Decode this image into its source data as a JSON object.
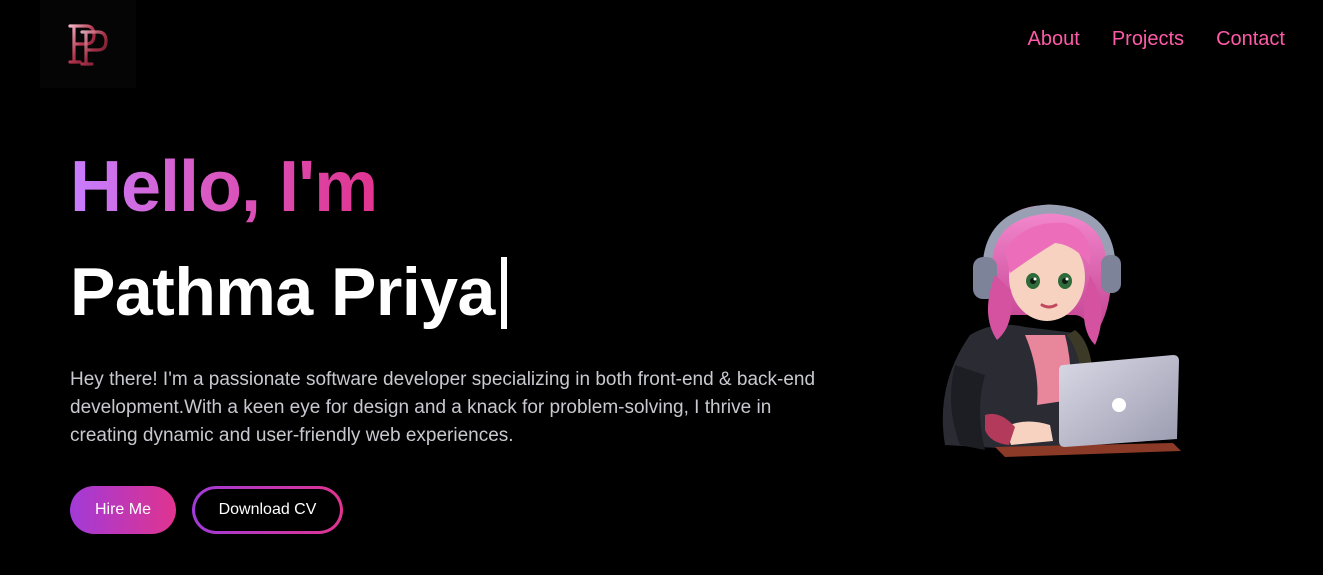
{
  "logo": {
    "monogram": "PP"
  },
  "nav": {
    "items": [
      {
        "label": "About"
      },
      {
        "label": "Projects"
      },
      {
        "label": "Contact"
      }
    ],
    "link_color": "#ff5aa8"
  },
  "hero": {
    "greeting": "Hello, I'm",
    "name": "Pathma Priya",
    "intro": "Hey there! I'm a passionate software developer specializing in both front-end & back-end development.With a keen eye for design and a knack for problem-solving, I thrive in creating dynamic and user-friendly web experiences.",
    "gradient_start": "#c77dff",
    "gradient_end": "#e0348f"
  },
  "buttons": {
    "hire_label": "Hire Me",
    "cv_label": "Download CV"
  },
  "illustration": {
    "icon": "developer-girl-with-laptop-icon"
  },
  "colors": {
    "background": "#000000",
    "accent": "#e0348f",
    "accent_purple": "#a23ad8"
  }
}
